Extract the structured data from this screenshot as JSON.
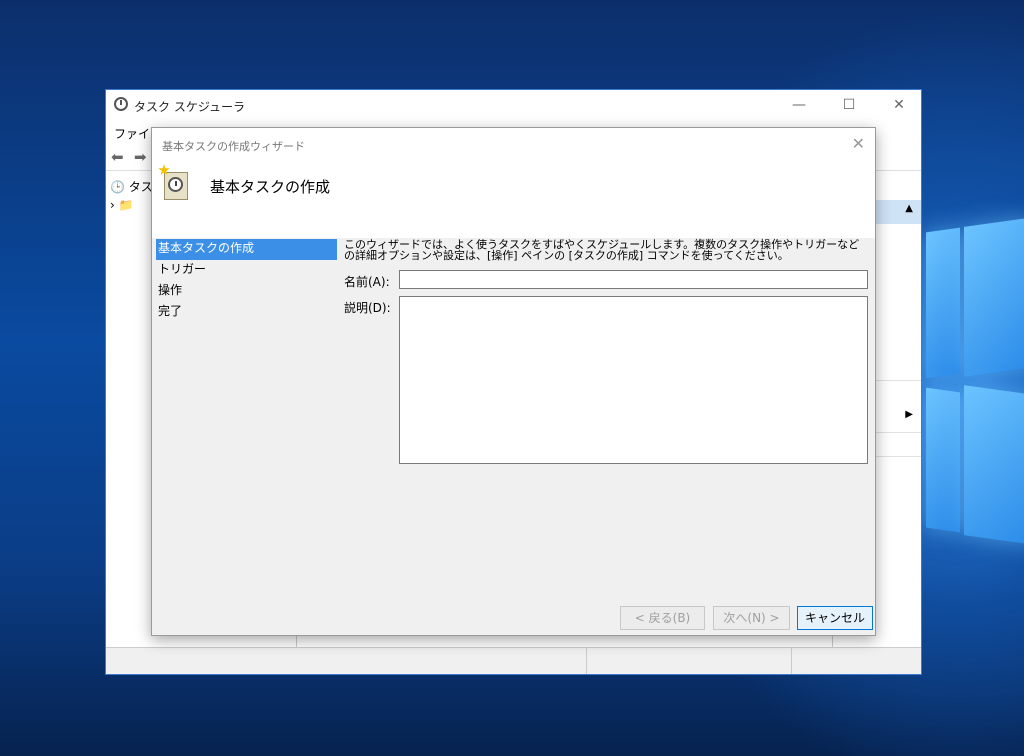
{
  "app_window": {
    "title": "タスク スケジューラ",
    "menubar_text": "ファイル",
    "tree_root_label": "タス",
    "controls": {
      "minimize": "—",
      "maximize": "☐",
      "close": "✕"
    }
  },
  "wizard": {
    "window_title": "基本タスクの作成ウィザード",
    "header_title": "基本タスクの作成",
    "close_glyph": "✕",
    "steps": [
      {
        "label": "基本タスクの作成",
        "active": true
      },
      {
        "label": "トリガー",
        "active": false
      },
      {
        "label": "操作",
        "active": false
      },
      {
        "label": "完了",
        "active": false
      }
    ],
    "description": "このウィザードでは、よく使うタスクをすばやくスケジュールします。複数のタスク操作やトリガーなどの詳細オプションや設定は、[操作] ペインの [タスクの作成] コマンドを使ってください。",
    "name_label": "名前(A):",
    "name_value": "",
    "description_label": "説明(D):",
    "description_value": "",
    "buttons": {
      "back": "< 戻る(B)",
      "next": "次へ(N) >",
      "cancel": "キャンセル"
    }
  },
  "colors": {
    "selected_step": "#3c8fe6",
    "desktop_blue": "#0a4aa0",
    "window_border": "#3c7ad0"
  }
}
